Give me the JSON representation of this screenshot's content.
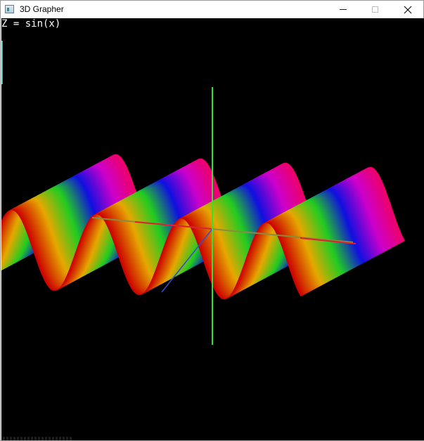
{
  "window": {
    "title": "3D Grapher",
    "minimize_icon": "minimize-icon",
    "maximize_icon": "maximize-icon",
    "close_icon": "close-icon",
    "close_glyph": "✕"
  },
  "viewport": {
    "equation": "Z = sin(x)",
    "background_color": "#000000",
    "axis_colors": {
      "vertical": "#33e033",
      "red_axis": "#e21f2f",
      "depth_axis": "#8a8a40",
      "blue_axis": "#3a4ad0"
    },
    "surface_palette": [
      "#cc0000",
      "#e6a800",
      "#22cc22",
      "#1010e0",
      "#cc00cc",
      "#ee0066"
    ]
  }
}
